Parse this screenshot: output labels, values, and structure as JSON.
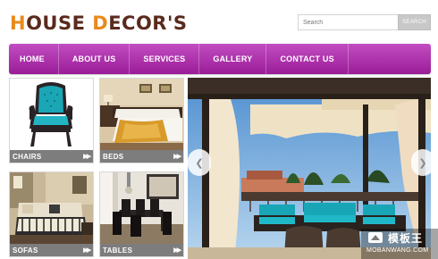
{
  "header": {
    "logo_first": "H",
    "logo_part1": "OUSE ",
    "logo_second": "D",
    "logo_part2": "ECOR'S",
    "search_placeholder": "Search",
    "search_button": "SEARCH"
  },
  "nav": {
    "items": [
      "HOME",
      "ABOUT US",
      "SERVICES",
      "GALLERY",
      "CONTACT US"
    ]
  },
  "tiles": [
    {
      "label": "CHAIRS"
    },
    {
      "label": "BEDS"
    },
    {
      "label": "SOFAS"
    },
    {
      "label": "TABLES"
    }
  ],
  "slider": {
    "prev_icon": "chevron-left-icon",
    "next_icon": "chevron-right-icon"
  },
  "watermark": {
    "cn": "模板王",
    "en": "MOBANWANG.COM"
  },
  "colors": {
    "nav_top": "#c24dc1",
    "nav_bottom": "#9a1c98",
    "logo_brown": "#5a2a1c",
    "logo_orange": "#e88a1a",
    "caption_bg": "#7d7d7d"
  }
}
